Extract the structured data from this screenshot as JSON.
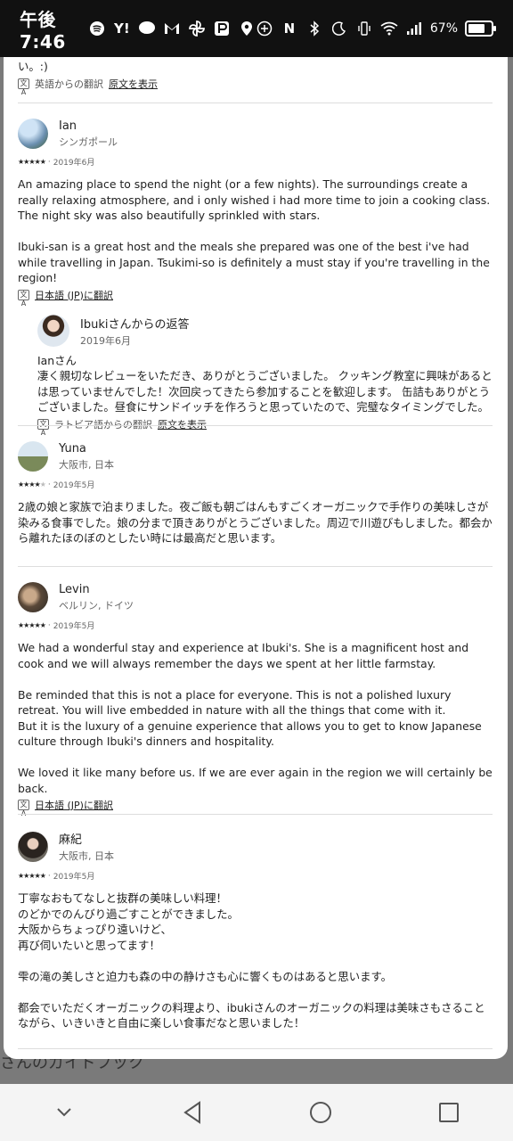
{
  "status_bar": {
    "time": "午後7:46",
    "battery": "67%",
    "left_icons": [
      "spotify-icon",
      "yahoo-icon",
      "line-icon",
      "gmail-icon",
      "pinwheel-icon",
      "paypay-icon",
      "location-icon"
    ],
    "right_icons": [
      "add-circle-icon",
      "nfc-icon",
      "bluetooth-icon",
      "moon-icon",
      "vibrate-icon",
      "wifi-icon",
      "signal-icon"
    ]
  },
  "top_fragment": {
    "text": "い。:)",
    "translated_from": "英語からの翻訳",
    "show_original": "原文を表示"
  },
  "reviews": [
    {
      "name": "Ian",
      "location": "シンガポール",
      "rating": 5,
      "date": "2019年6月",
      "body": "An amazing place to spend the night (or a few nights). The surroundings create a really relaxing atmosphere, and i only wished i had more time to join a cooking class. The night sky was also beautifully sprinkled with stars.\n\nIbuki-san is a great host and the meals she prepared was one of the best i've had while travelling in Japan. Tsukimi-so is definitely a must stay if you're travelling in the region!",
      "translate_link": "日本語 (JP)に翻訳",
      "reply": {
        "title": "Ibukiさんからの返答",
        "date": "2019年6月",
        "body": "Ianさん\n凄く親切なレビューをいただき、ありがとうございました。 クッキング教室に興味があるとは思っていませんでした！次回戻ってきたら参加することを歓迎します。 缶詰もありがとうございました。昼食にサンドイッチを作ろうと思っていたので、完璧なタイミングでした。",
        "translated_from": "ラトビア語からの翻訳",
        "show_original": "原文を表示"
      }
    },
    {
      "name": "Yuna",
      "location": "大阪市, 日本",
      "rating": 4,
      "date": "2019年5月",
      "body": "2歳の娘と家族で泊まりました。夜ご飯も朝ごはんもすごくオーガニックで手作りの美味しさが染みる食事でした。娘の分まで頂きありがとうございました。周辺で川遊びもしました。都会から離れたほのぼのとしたい時には最高だと思います。"
    },
    {
      "name": "Levin",
      "location": "ベルリン, ドイツ",
      "rating": 5,
      "date": "2019年5月",
      "body": "We had a wonderful stay and experience at Ibuki's. She is a magnificent host and cook and we will always remember the days we spent at her little farmstay.\n\nBe reminded that this is not a place for everyone. This is not a polished luxury retreat. You will live embedded in nature with all the things that come with it.\nBut it is the luxury of a genuine experience that allows you to get to know Japanese culture through Ibuki's dinners and hospitality.\n\nWe loved it like many before us. If we are ever again in the region we will certainly be back.",
      "translate_link": "日本語 (JP)に翻訳"
    },
    {
      "name": "麻紀",
      "location": "大阪市, 日本",
      "rating": 5,
      "date": "2019年5月",
      "body": "丁寧なおもてなしと抜群の美味しい料理！\nのどかでのんびり過ごすことができました。\n大阪からちょっぴり遠いけど、\n再び伺いたいと思ってます！\n\n雫の滝の美しさと迫力も森の中の静けさも心に響くものはあると思います。\n\n都会でいただくオーガニックの料理より、ibukiさんのオーガニックの料理は美味さもさることながら、いきいきと自由に楽しい食事だなと思いました！"
    }
  ],
  "background": {
    "guidebook_text": "さんのガイドブック"
  },
  "colors": {
    "status_bar": "#111111",
    "backdrop": "#7a7a7a",
    "sheet": "#ffffff",
    "text": "#222222"
  }
}
